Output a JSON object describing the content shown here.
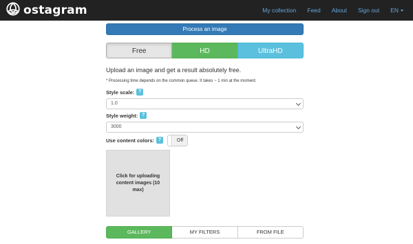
{
  "navbar": {
    "brand": "ostagram",
    "links": [
      "My collection",
      "Feed",
      "About",
      "Sign out"
    ],
    "language": "EN"
  },
  "process_button": "Process an image",
  "plans": {
    "free": "Free",
    "hd": "HD",
    "ultrahd": "UltraHD",
    "selected": "Free"
  },
  "description": "Upload an image and get a result absolutely free.",
  "note": "* Processing time depends on the common queue. It takes ~ 1 min at the moment.",
  "style_scale": {
    "label": "Style scale:",
    "help": "?",
    "value": "1.0"
  },
  "style_weight": {
    "label": "Style weight:",
    "help": "?",
    "value": "3000"
  },
  "content_colors": {
    "label": "Use content colors:",
    "help": "?",
    "toggle": "Off"
  },
  "upload": {
    "text": "Click for uploading content images (10 max)"
  },
  "tabs": {
    "gallery": "GALLERY",
    "my_filters": "MY FILTERS",
    "from_file": "FROM FILE",
    "active": "GALLERY"
  },
  "colors": {
    "navbar_bg": "#222222",
    "nav_link": "#65a5dd",
    "primary": "#337ab7",
    "success": "#5cb85c",
    "info": "#5bc0de"
  }
}
